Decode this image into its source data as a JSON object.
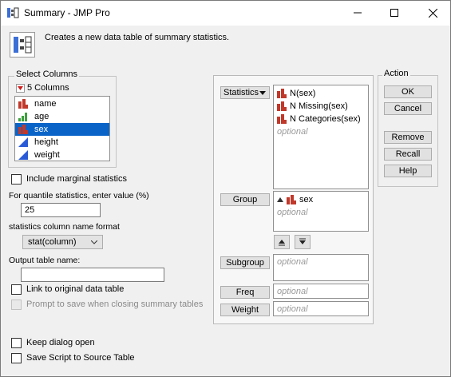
{
  "window": {
    "title": "Summary - JMP Pro",
    "description": "Creates a new data table of summary statistics."
  },
  "select_columns": {
    "title": "Select Columns",
    "count_label": "5 Columns",
    "columns": [
      {
        "name": "name",
        "type": "nominal"
      },
      {
        "name": "age",
        "type": "ordinal"
      },
      {
        "name": "sex",
        "type": "nominal",
        "selected": true
      },
      {
        "name": "height",
        "type": "continuous"
      },
      {
        "name": "weight",
        "type": "continuous"
      }
    ]
  },
  "options": {
    "include_marginal": "Include marginal statistics",
    "quantile_label": "For quantile statistics, enter value (%)",
    "quantile_value": "25",
    "format_label": "statistics column name format",
    "format_value": "stat(column)",
    "output_label": "Output table name:",
    "output_value": "",
    "link_label": "Link to original data table",
    "prompt_label": "Prompt to save when closing summary tables",
    "keep_open_label": "Keep dialog open",
    "save_script_label": "Save Script to Source Table"
  },
  "roles": {
    "statistics": {
      "label": "Statistics",
      "items": [
        "N(sex)",
        "N Missing(sex)",
        "N Categories(sex)"
      ],
      "placeholder": "optional"
    },
    "group": {
      "label": "Group",
      "items": [
        "sex"
      ],
      "placeholder": "optional"
    },
    "subgroup": {
      "label": "Subgroup",
      "placeholder": "optional"
    },
    "freq": {
      "label": "Freq",
      "placeholder": "optional"
    },
    "weight": {
      "label": "Weight",
      "placeholder": "optional"
    }
  },
  "action": {
    "title": "Action",
    "ok": "OK",
    "cancel": "Cancel",
    "remove": "Remove",
    "recall": "Recall",
    "help": "Help"
  },
  "colors": {
    "selection": "#0a64c8",
    "nominal_icon": "#c0392b",
    "ordinal_icon": "#3aa13a",
    "continuous_icon": "#2a5bd7"
  }
}
